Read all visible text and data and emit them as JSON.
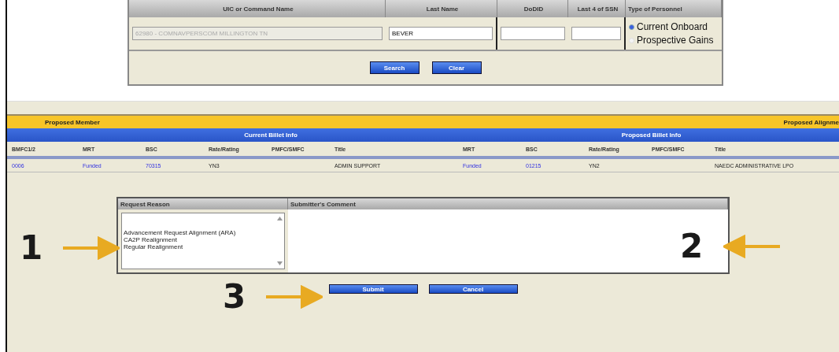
{
  "search": {
    "columns": [
      "UIC or Command Name",
      "Last Name",
      "DoDID",
      "Last 4 of SSN",
      "Type of Personnel"
    ],
    "uic": {
      "value": "62980 - COMNAVPERSCOM MILLINGTON TN",
      "disabled": true
    },
    "last_name": {
      "value": "BEVER"
    },
    "personnel_types": [
      {
        "label": "Current Onboard",
        "selected": true
      },
      {
        "label": "Prospective Gains",
        "selected": false
      }
    ],
    "buttons": [
      "Search",
      "Clear"
    ]
  },
  "member_bar": {
    "left": "Proposed Member",
    "right": "Proposed Alignme"
  },
  "billet_groups": [
    "Current Billet Info",
    "Proposed Billet Info"
  ],
  "table": {
    "columns": [
      "BMFC1/2",
      "MRT",
      "BSC",
      "Rate/Rating",
      "PMFC/SMFC",
      "Title",
      "MRT",
      "BSC",
      "Rate/Rating",
      "PMFC/SMFC",
      "Title"
    ],
    "rows": [
      {
        "cells": [
          {
            "text": "0006",
            "link": true
          },
          {
            "text": "Funded",
            "link": true
          },
          {
            "text": "70315",
            "link": true
          },
          {
            "text": "YN3",
            "link": false
          },
          {
            "text": ""
          },
          {
            "text": "ADMIN SUPPORT",
            "link": false
          },
          {
            "text": "Funded",
            "link": true
          },
          {
            "text": "01215",
            "link": true
          },
          {
            "text": "YN2",
            "link": false
          },
          {
            "text": ""
          },
          {
            "text": "NAEDC ADMINISTRATIVE LPO",
            "link": false
          }
        ]
      }
    ]
  },
  "request": {
    "reason_label": "Request Reason",
    "comment_label": "Submitter's Comment",
    "reasons": [
      {
        "label": "Advancement Request Alignment (ARA)",
        "selected": false
      },
      {
        "label": "CA2P Realignment",
        "selected": false
      },
      {
        "label": "Regular Realignment",
        "selected": false
      }
    ],
    "buttons": [
      "Submit",
      "Cancel"
    ]
  },
  "callouts": [
    "1",
    "2",
    "3"
  ]
}
